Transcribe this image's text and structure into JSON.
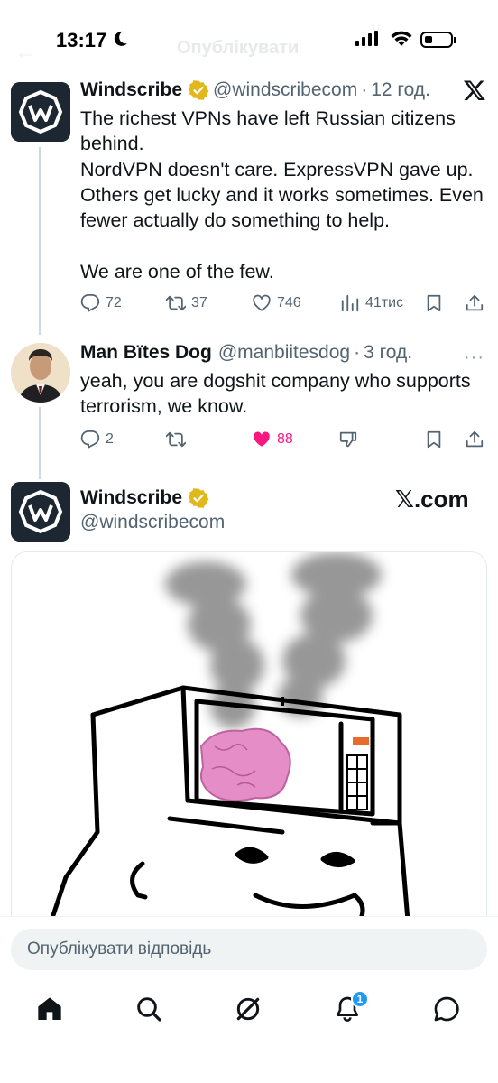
{
  "status_bar": {
    "time": "13:17",
    "ghost_title": "Опублікувати",
    "battery_level": 0.3
  },
  "thread": [
    {
      "name": "Windscribe",
      "handle": "@windscribecom",
      "time": "12 год.",
      "text": "The richest VPNs have left Russian citizens behind.\nNordVPN doesn't care. ExpressVPN gave up. Others get lucky and it works sometimes. Even fewer actually do something to help.\n\nWe are one of the few.",
      "stats": {
        "replies": "72",
        "retweets": "37",
        "likes": "746",
        "views": "41тис"
      }
    },
    {
      "name": "Man Bïtes Dog",
      "handle": "@manbiitesdog",
      "time": "3 год.",
      "text": "yeah, you are dogshit company who supports terrorism, we know.",
      "stats": {
        "replies": "2",
        "retweets": "",
        "likes": "88"
      }
    },
    {
      "name": "Windscribe",
      "handle": "@windscribecom",
      "brand": "𝕏.com"
    }
  ],
  "reply_bar": {
    "placeholder": "Опублікувати відповідь"
  },
  "tab_bar": {
    "notifications_badge": "1"
  },
  "colors": {
    "like": "#f91880",
    "verified": "#e2b719",
    "accent": "#1d9bf0"
  }
}
